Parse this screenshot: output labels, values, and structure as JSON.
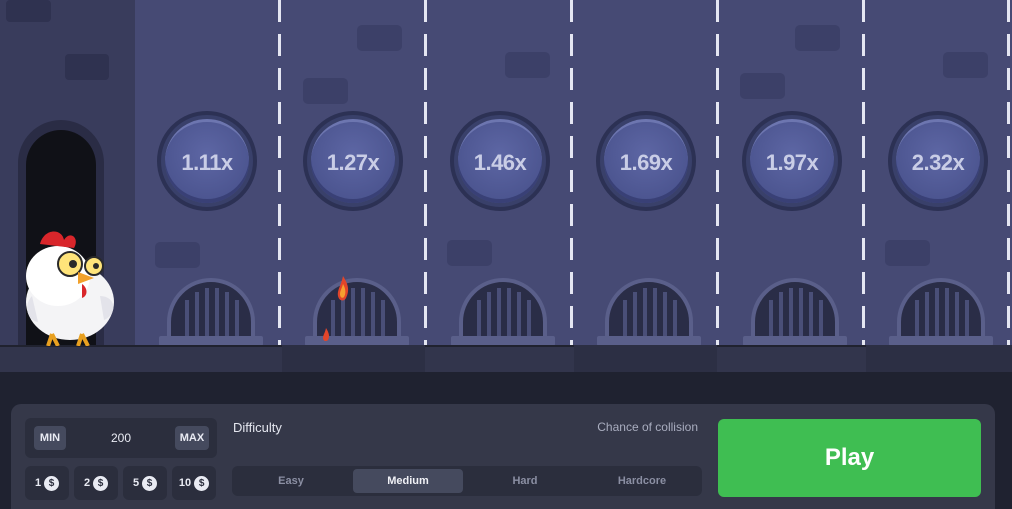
{
  "game": {
    "multipliers": [
      "1.11x",
      "1.27x",
      "1.46x",
      "1.69x",
      "1.97x",
      "2.32x"
    ]
  },
  "bet": {
    "min_label": "MIN",
    "amount": "200",
    "max_label": "MAX",
    "chips": [
      {
        "label": "1",
        "icon": "dollar-icon"
      },
      {
        "label": "2",
        "icon": "dollar-icon"
      },
      {
        "label": "5",
        "icon": "dollar-icon"
      },
      {
        "label": "10",
        "icon": "dollar-icon"
      }
    ]
  },
  "difficulty": {
    "label": "Difficulty",
    "chance_label": "Chance of collision",
    "options": [
      "Easy",
      "Medium",
      "Hard",
      "Hardcore"
    ],
    "selected": "Medium"
  },
  "play_button": {
    "label": "Play",
    "color": "#3fbe52"
  },
  "colors": {
    "scene_bg": "#464a74",
    "coin": "#4c5590",
    "panel_bg": "#353849"
  }
}
